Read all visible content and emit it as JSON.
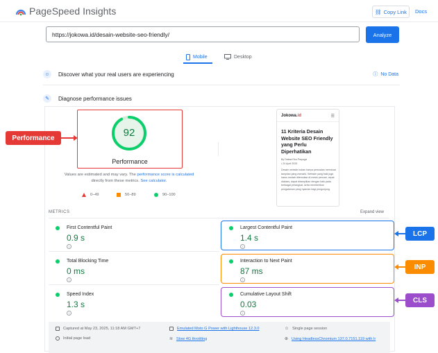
{
  "header": {
    "app_title": "PageSpeed Insights",
    "copy_link": "Copy Link",
    "docs": "Docs"
  },
  "url_bar": {
    "value": "https://jokowa.id/desain-website-seo-friendly/",
    "analyze": "Analyze"
  },
  "tabs": [
    {
      "label": "Mobile",
      "selected": true
    },
    {
      "label": "Desktop",
      "selected": false
    }
  ],
  "field_section": {
    "title": "Discover what your real users are experiencing",
    "status": "No Data"
  },
  "lab_section": {
    "title": "Diagnose performance issues"
  },
  "performance": {
    "score": "92",
    "score_fraction": 0.92,
    "label": "Performance",
    "note_prefix": "Values are estimated and may vary. The ",
    "note_link1": "performance score is calculated",
    "note_mid": " directly from these metrics. ",
    "note_link2": "See calculator.",
    "legend": [
      "0–49",
      "50–89",
      "90–100"
    ]
  },
  "annotations": {
    "performance_tag": "Performance",
    "lcp_tag": "LCP",
    "inp_tag": "INP",
    "cls_tag": "CLS",
    "colors": {
      "red": "#e53935",
      "blue": "#1a73e8",
      "orange": "#fb8c00",
      "purple": "#9c4dcc"
    }
  },
  "preview": {
    "brand": "Jokowa",
    "brand_suffix": ".id",
    "title": "11 Kriteria Desain Website SEO Friendly yang Perlu Diperhatikan",
    "byline": "By Daksa Eka Prayoga",
    "date": "• 24 April 2025",
    "body": "Desain website bukan hanya persoalan membuat tampilan yang menarik. Website yang baik juga harus mudah ditemukan di mesin pencari, cepat diakses, dapat ditampilkan dengan baik pada berbagai perangkat, serta memberikan pengalaman yang nyaman bagi pengunjung."
  },
  "metrics": {
    "heading": "METRICS",
    "expand": "Expand view",
    "items": [
      {
        "name": "First Contentful Paint",
        "value": "0.9 s"
      },
      {
        "name": "Largest Contentful Paint",
        "value": "1.4 s"
      },
      {
        "name": "Total Blocking Time",
        "value": "0 ms"
      },
      {
        "name": "Interaction to Next Paint",
        "value": "87 ms"
      },
      {
        "name": "Speed Index",
        "value": "1.3 s"
      },
      {
        "name": "Cumulative Layout Shift",
        "value": "0.03"
      }
    ]
  },
  "footer": {
    "captured": "Captured at May 23, 2025, 11:18 AM GMT+7",
    "initial_load": "Initial page load",
    "device": "Emulated Moto G Power with Lighthouse 12.3.0",
    "throttling": "Slow 4G throttling",
    "session": "Single page session",
    "browser": "Using HeadlessChromium 137.0.7151.119 with lr"
  }
}
